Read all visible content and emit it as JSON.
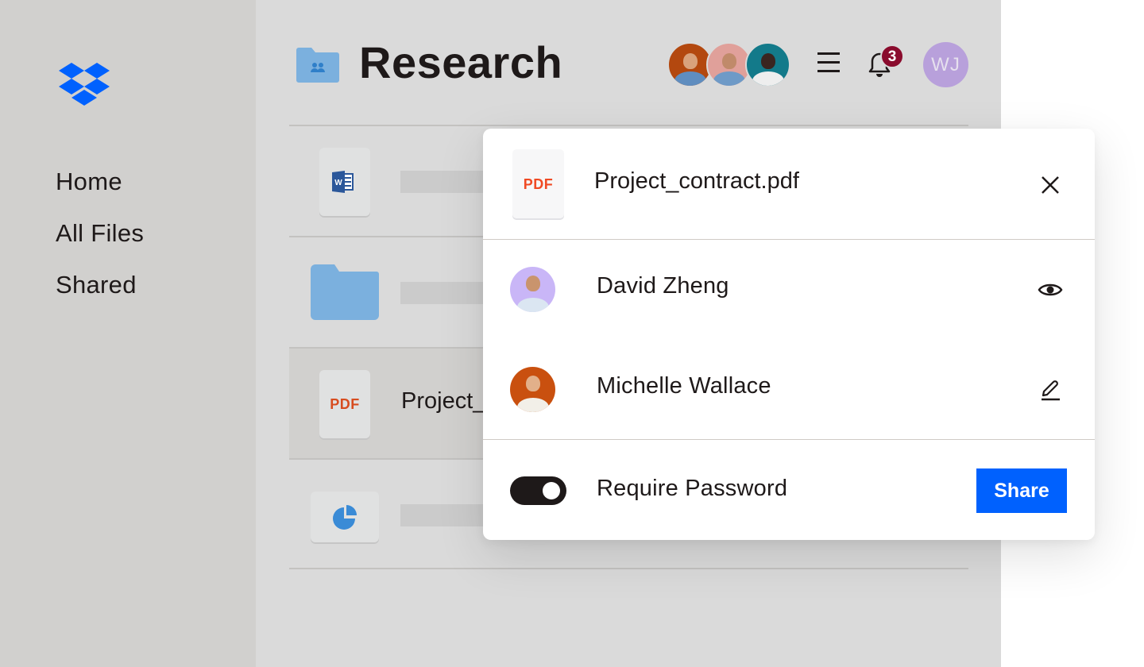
{
  "brand": {
    "logo_icon": "dropbox-logo-icon",
    "color": "#0061fe"
  },
  "sidebar": {
    "items": [
      {
        "label": "Home"
      },
      {
        "label": "All Files"
      },
      {
        "label": "Shared"
      }
    ]
  },
  "header": {
    "folder_icon": "shared-folder-icon",
    "title": "Research",
    "collaborators": [
      {
        "avatar": "collaborator-avatar-1",
        "bg": "#b3480f"
      },
      {
        "avatar": "collaborator-avatar-2",
        "bg": "#e0a09a"
      },
      {
        "avatar": "collaborator-avatar-3",
        "bg": "#137a8a"
      }
    ],
    "menu_icon": "hamburger-menu-icon",
    "notifications": {
      "icon": "bell-icon",
      "count": "3",
      "badge_color": "#8a0b2d"
    },
    "user": {
      "initials": "WJ",
      "bg": "#b8a0db"
    }
  },
  "files": [
    {
      "type": "word",
      "icon": "word-doc-icon",
      "label": ""
    },
    {
      "type": "folder",
      "icon": "folder-icon",
      "label": ""
    },
    {
      "type": "pdf",
      "icon": "pdf-file-icon",
      "icon_text": "PDF",
      "label": "Project_",
      "selected": true
    },
    {
      "type": "chart",
      "icon": "pie-chart-file-icon",
      "label": ""
    }
  ],
  "share_dialog": {
    "file_icon_text": "PDF",
    "file_name": "Project_contract.pdf",
    "close_icon": "close-icon",
    "people": [
      {
        "name": "David Zheng",
        "avatar_bg": "#c9b6f7",
        "permission": "view",
        "permission_icon": "eye-icon"
      },
      {
        "name": "Michelle Wallace",
        "avatar_bg": "#c9500f",
        "permission": "edit",
        "permission_icon": "pencil-icon"
      }
    ],
    "require_password": {
      "label": "Require Password",
      "enabled": true
    },
    "share_button": "Share",
    "share_button_color": "#0061fe"
  }
}
